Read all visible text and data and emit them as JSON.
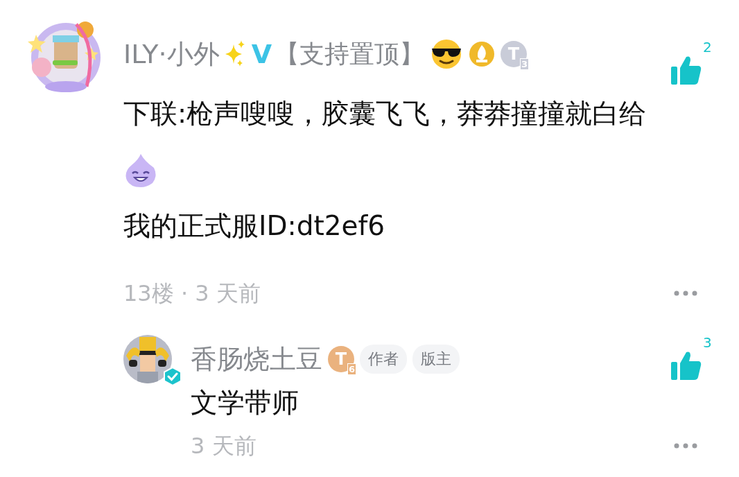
{
  "comments": [
    {
      "kind": "comment",
      "user": {
        "name": "ILY·小外",
        "sparkle": true,
        "v_badge": "V",
        "tag": "【支持置顶】",
        "emoji": true,
        "medal": true,
        "level_badge": {
          "letter": "T",
          "level": "3",
          "color": "#c9ccd8"
        }
      },
      "likes": "2",
      "paragraphs": [
        {
          "kind": "text",
          "text": "下联:枪声嗖嗖，胶囊飞飞，莽莽撞撞就白给"
        },
        {
          "kind": "sticker"
        },
        {
          "kind": "text",
          "text": "我的正式服ID:dt2ef6"
        }
      ],
      "meta": "13楼 · 3 天前"
    },
    {
      "kind": "reply",
      "user": {
        "name": "香肠烧土豆",
        "level_badge": {
          "letter": "T",
          "level": "6",
          "color": "#eab27e"
        },
        "verified": true,
        "tags": [
          "作者",
          "版主"
        ]
      },
      "likes": "3",
      "paragraphs": [
        {
          "kind": "text",
          "text": "文学带师"
        }
      ],
      "meta": "3 天前"
    }
  ]
}
